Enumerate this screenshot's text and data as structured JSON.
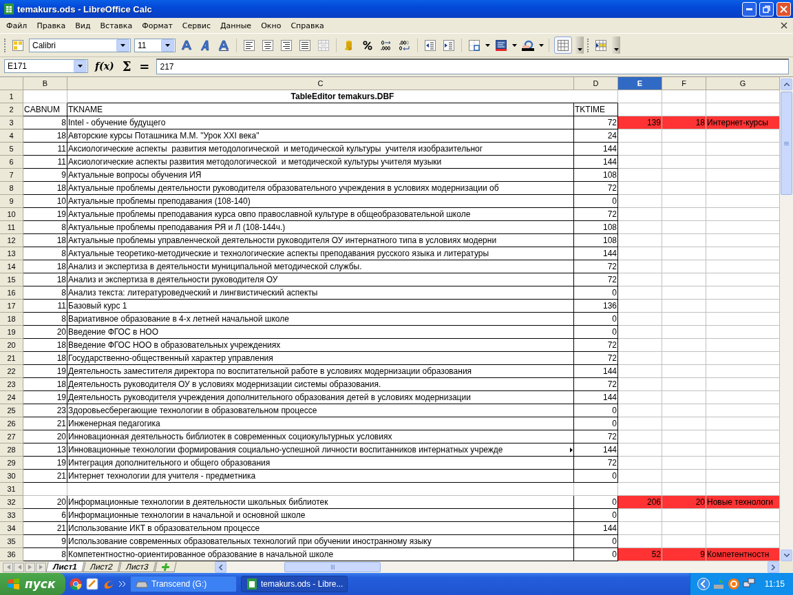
{
  "window": {
    "title": "temakurs.ods - LibreOffice Calc"
  },
  "menu": [
    "Файл",
    "Правка",
    "Вид",
    "Вставка",
    "Формат",
    "Сервис",
    "Данные",
    "Окно",
    "Справка"
  ],
  "toolbar": {
    "font_name": "Calibri",
    "font_size": "11",
    "grid_toggle_on": true
  },
  "formula_bar": {
    "cell_ref": "E171",
    "function_wizard": "f(x)",
    "sum": "Σ",
    "equals": "=",
    "value": "217"
  },
  "sheet": {
    "columns": [
      {
        "label": "B",
        "selected": false
      },
      {
        "label": "C",
        "selected": false
      },
      {
        "label": "D",
        "selected": false
      },
      {
        "label": "E",
        "selected": true
      },
      {
        "label": "F",
        "selected": false
      },
      {
        "label": "G",
        "selected": false
      }
    ],
    "title_row": {
      "number": "1",
      "text": "TableEditor temakurs.DBF"
    },
    "header_row": {
      "number": "2",
      "cells": [
        "CABNUM",
        "TKNAME",
        "TKTIME"
      ]
    },
    "rows": [
      {
        "number": "3",
        "cabnum": "8",
        "tkname": "Intel - обучение будущего",
        "tktime": "72",
        "highlighted": true,
        "overflow": false,
        "e": "139",
        "f": "18",
        "g": "Интернет-курсы"
      },
      {
        "number": "4",
        "cabnum": "18",
        "tkname": "Авторские курсы Поташника М.М. \"Урок XXI века\"",
        "tktime": "24",
        "highlighted": false,
        "overflow": false
      },
      {
        "number": "5",
        "cabnum": "11",
        "tkname": "Аксиологические аспекты  развития методологической  и методической культуры  учителя изобразительног",
        "tktime": "144",
        "highlighted": false,
        "overflow": false
      },
      {
        "number": "6",
        "cabnum": "11",
        "tkname": "Аксиологические аспекты развития методологической  и методической культуры учителя музыки",
        "tktime": "144",
        "highlighted": false,
        "overflow": false
      },
      {
        "number": "7",
        "cabnum": "9",
        "tkname": "Актуальные вопросы обучения ИЯ",
        "tktime": "108",
        "highlighted": false,
        "overflow": false
      },
      {
        "number": "8",
        "cabnum": "18",
        "tkname": "Актуальные проблемы деятельности руководителя образовательного учреждения в условиях модернизации об",
        "tktime": "72",
        "highlighted": false,
        "overflow": false
      },
      {
        "number": "9",
        "cabnum": "10",
        "tkname": "Актуальные проблемы преподавания (108-140)",
        "tktime": "0",
        "highlighted": false,
        "overflow": false
      },
      {
        "number": "10",
        "cabnum": "19",
        "tkname": "Актуальные проблемы преподавания курса овпо православной культуре в общеобразовательной школе",
        "tktime": "72",
        "highlighted": false,
        "overflow": false
      },
      {
        "number": "11",
        "cabnum": "8",
        "tkname": "Актуальные проблемы преподавания РЯ и Л (108-144ч.)",
        "tktime": "108",
        "highlighted": false,
        "overflow": false
      },
      {
        "number": "12",
        "cabnum": "18",
        "tkname": "Актуальные проблемы управленческой деятельности руководителя ОУ интернатного типа в условиях модерни",
        "tktime": "108",
        "highlighted": false,
        "overflow": false
      },
      {
        "number": "13",
        "cabnum": "8",
        "tkname": "Актуальные теоретико-методические и технологические аспекты преподавания русского языка и литературы",
        "tktime": "144",
        "highlighted": false,
        "overflow": false
      },
      {
        "number": "14",
        "cabnum": "18",
        "tkname": "Анализ и экспертиза в деятельности муниципальной методической службы.",
        "tktime": "72",
        "highlighted": false,
        "overflow": false
      },
      {
        "number": "15",
        "cabnum": "18",
        "tkname": "Анализ и экспертиза в деятельности руководителя ОУ",
        "tktime": "72",
        "highlighted": false,
        "overflow": false
      },
      {
        "number": "16",
        "cabnum": "8",
        "tkname": "Анализ текста: литературоведческий и лингвистический аспекты",
        "tktime": "0",
        "highlighted": false,
        "overflow": false
      },
      {
        "number": "17",
        "cabnum": "11",
        "tkname": "Базовый курс 1",
        "tktime": "136",
        "highlighted": false,
        "overflow": false
      },
      {
        "number": "18",
        "cabnum": "8",
        "tkname": "Вариативное образование в 4-х летней начальной школе",
        "tktime": "0",
        "highlighted": false,
        "overflow": false
      },
      {
        "number": "19",
        "cabnum": "20",
        "tkname": "Введение ФГОС в НОО",
        "tktime": "0",
        "highlighted": false,
        "overflow": false
      },
      {
        "number": "20",
        "cabnum": "18",
        "tkname": "Введение ФГОС НОО в образовательных учреждениях",
        "tktime": "72",
        "highlighted": false,
        "overflow": false
      },
      {
        "number": "21",
        "cabnum": "18",
        "tkname": "Государственно-общественный характер управления",
        "tktime": "72",
        "highlighted": false,
        "overflow": false
      },
      {
        "number": "22",
        "cabnum": "19",
        "tkname": "Деятельность заместителя директора по воспитательной работе в условиях модернизации образования",
        "tktime": "144",
        "highlighted": false,
        "overflow": false
      },
      {
        "number": "23",
        "cabnum": "18",
        "tkname": "Деятельность руководителя ОУ в условиях модернизации системы образования.",
        "tktime": "72",
        "highlighted": false,
        "overflow": false
      },
      {
        "number": "24",
        "cabnum": "19",
        "tkname": "Деятельность руководителя учреждения дополнительного образования детей в условиях модернизации",
        "tktime": "144",
        "highlighted": false,
        "overflow": false
      },
      {
        "number": "25",
        "cabnum": "23",
        "tkname": "Здоровьесберегающие технологии в образовательном процессе",
        "tktime": "0",
        "highlighted": false,
        "overflow": false
      },
      {
        "number": "26",
        "cabnum": "21",
        "tkname": "Инженерная педагогика",
        "tktime": "0",
        "highlighted": false,
        "overflow": false
      },
      {
        "number": "27",
        "cabnum": "20",
        "tkname": "Инновационная деятельность библиотек в современных социокультурных условиях",
        "tktime": "72",
        "highlighted": false,
        "overflow": false
      },
      {
        "number": "28",
        "cabnum": "13",
        "tkname": "Инновационные технологии формирования социально-успешной личности воспитанников интернатных учрежде",
        "tktime": "144",
        "highlighted": false,
        "overflow": true
      },
      {
        "number": "29",
        "cabnum": "19",
        "tkname": "Интеграция дополнительного и общего образования",
        "tktime": "72",
        "highlighted": false,
        "overflow": false
      },
      {
        "number": "30",
        "cabnum": "21",
        "tkname": "Интернет технологии для учителя - предметника",
        "tktime": "0",
        "highlighted": false,
        "overflow": false
      },
      {
        "number": "31",
        "highlighted": false
      },
      {
        "number": "32",
        "cabnum": "20",
        "tkname": "Информационные технологии в деятельности школьных библиотек",
        "tktime": "0",
        "highlighted": true,
        "overflow": false,
        "e": "206",
        "f": "20",
        "g": "Новые технологи"
      },
      {
        "number": "33",
        "cabnum": "6",
        "tkname": "Информационные технологии в начальной и основной школе",
        "tktime": "0",
        "highlighted": false,
        "overflow": false
      },
      {
        "number": "34",
        "cabnum": "21",
        "tkname": "Использование ИКТ в образовательном процессе",
        "tktime": "144",
        "highlighted": false,
        "overflow": false
      },
      {
        "number": "35",
        "cabnum": "9",
        "tkname": "Использование современных образовательных технологий при обучении иностранному языку",
        "tktime": "0",
        "highlighted": false,
        "overflow": false
      },
      {
        "number": "36",
        "cabnum": "8",
        "tkname": "Компетентностно-ориентированное образование в начальной школе",
        "tktime": "0",
        "highlighted": true,
        "overflow": false,
        "e": "52",
        "f": "9",
        "g": "Компетентностн"
      }
    ]
  },
  "sheet_tabs": [
    {
      "label": "Лист1",
      "selected": true
    },
    {
      "label": "Лист2",
      "selected": false
    },
    {
      "label": "Лист3",
      "selected": false
    }
  ],
  "taskbar": {
    "start": "пуск",
    "tasks": [
      {
        "label": "Transcend (G:)",
        "selected": false
      },
      {
        "label": "temakurs.ods - Libre...",
        "selected": true
      }
    ],
    "clock": "11:15"
  }
}
